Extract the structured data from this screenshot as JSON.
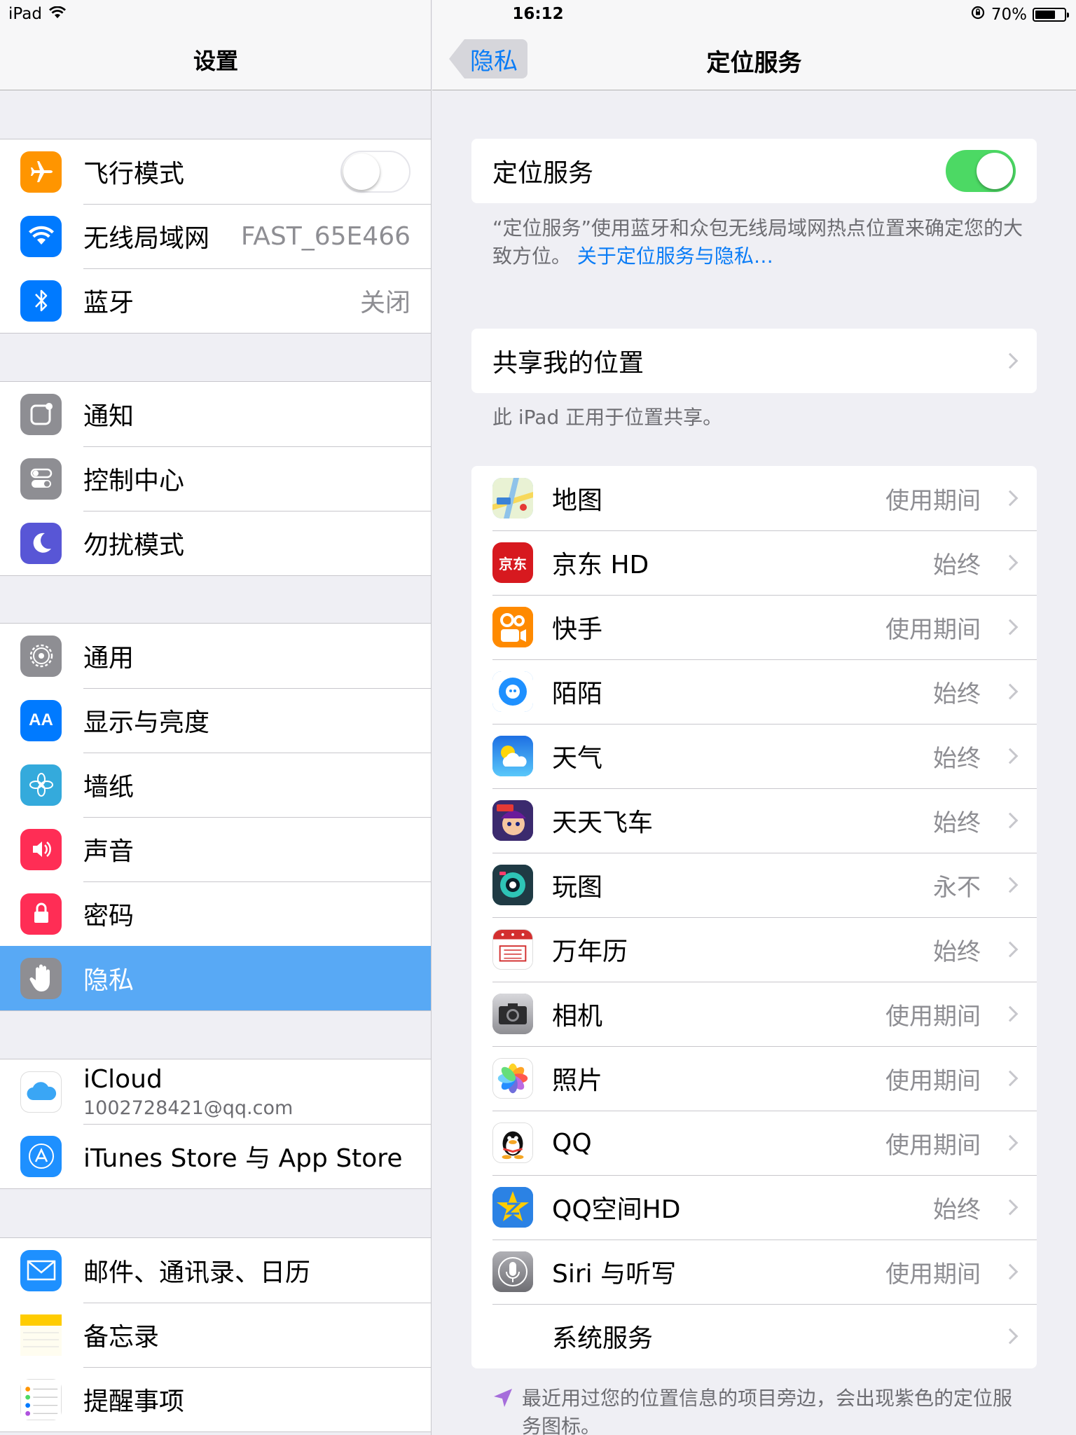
{
  "status_bar": {
    "device": "iPad",
    "time": "16:12",
    "battery": "70%",
    "battery_level": 0.7
  },
  "left": {
    "title": "设置",
    "groups": [
      [
        {
          "label": "飞行模式",
          "icon": "airplane-icon",
          "color": "#ff9500",
          "toggle": "off"
        },
        {
          "label": "无线局域网",
          "value": "FAST_65E466",
          "icon": "wifi-icon",
          "color": "#007aff"
        },
        {
          "label": "蓝牙",
          "value": "关闭",
          "icon": "bluetooth-icon",
          "color": "#007aff"
        }
      ],
      [
        {
          "label": "通知",
          "icon": "notification-icon",
          "color": "#8e8e93"
        },
        {
          "label": "控制中心",
          "icon": "control-center-icon",
          "color": "#8e8e93"
        },
        {
          "label": "勿扰模式",
          "icon": "moon-icon",
          "color": "#5856d6"
        }
      ],
      [
        {
          "label": "通用",
          "icon": "gear-icon",
          "color": "#8e8e93"
        },
        {
          "label": "显示与亮度",
          "icon": "display-icon",
          "color": "#007aff"
        },
        {
          "label": "墙纸",
          "icon": "wallpaper-icon",
          "color": "#34aadc"
        },
        {
          "label": "声音",
          "icon": "speaker-icon",
          "color": "#ff2d55"
        },
        {
          "label": "密码",
          "icon": "lock-icon",
          "color": "#ff2d55"
        },
        {
          "label": "隐私",
          "icon": "hand-icon",
          "color": "#8e8e93",
          "selected": true
        }
      ],
      [
        {
          "label": "iCloud",
          "sublabel": "1002728421@qq.com",
          "icon": "icloud-icon",
          "color": "#ffffff"
        },
        {
          "label": "iTunes Store 与 App Store",
          "icon": "appstore-icon",
          "color": "#1e90ff"
        }
      ],
      [
        {
          "label": "邮件、通讯录、日历",
          "icon": "mail-icon",
          "color": "#1e90ff"
        },
        {
          "label": "备忘录",
          "icon": "notes-icon",
          "color": "#ffcc00"
        },
        {
          "label": "提醒事项",
          "icon": "reminders-icon",
          "color": "#ffffff"
        }
      ]
    ]
  },
  "right": {
    "back_label": "隐私",
    "title": "定位服务",
    "location_services": {
      "label": "定位服务",
      "toggle": "on"
    },
    "location_footer": "“定位服务”使用蓝牙和众包无线局域网热点位置来确定您的大致方位。",
    "location_link": "关于定位服务与隐私…",
    "share_location": {
      "label": "共享我的位置"
    },
    "share_footer": "此 iPad 正用于位置共享。",
    "apps": [
      {
        "label": "地图",
        "value": "使用期间",
        "icon": "maps-icon",
        "color": "#7ec8f0"
      },
      {
        "label": "京东 HD",
        "value": "始终",
        "icon": "jd-icon",
        "color": "#d7191f",
        "glyph": "京东"
      },
      {
        "label": "快手",
        "value": "使用期间",
        "icon": "kuaishou-icon",
        "color": "#ff8a00"
      },
      {
        "label": "陌陌",
        "value": "始终",
        "icon": "momo-icon",
        "color": "#1e90ff"
      },
      {
        "label": "天气",
        "value": "始终",
        "icon": "weather-icon",
        "color": "#3a9bf0"
      },
      {
        "label": "天天飞车",
        "value": "始终",
        "icon": "racing-game-icon",
        "color": "#3b2a6e"
      },
      {
        "label": "玩图",
        "value": "永不",
        "icon": "wantu-icon",
        "color": "#1f8a8a"
      },
      {
        "label": "万年历",
        "value": "始终",
        "icon": "calendar-icon",
        "color": "#ffffff"
      },
      {
        "label": "相机",
        "value": "使用期间",
        "icon": "camera-icon",
        "color": "#8e8e93"
      },
      {
        "label": "照片",
        "value": "使用期间",
        "icon": "photos-icon",
        "color": "#ffffff"
      },
      {
        "label": "QQ",
        "value": "使用期间",
        "icon": "qq-penguin-icon",
        "color": "#ffffff"
      },
      {
        "label": "QQ空间HD",
        "value": "始终",
        "icon": "qzone-icon",
        "color": "#2b82e4"
      },
      {
        "label": "Siri 与听写",
        "value": "使用期间",
        "icon": "siri-mic-icon",
        "color": "#8e8e93"
      },
      {
        "label": "系统服务",
        "value": "",
        "icon": "",
        "color": ""
      }
    ],
    "bottom_footer": "最近用过您的位置信息的项目旁边，会出现紫色的定位服务图标。"
  }
}
